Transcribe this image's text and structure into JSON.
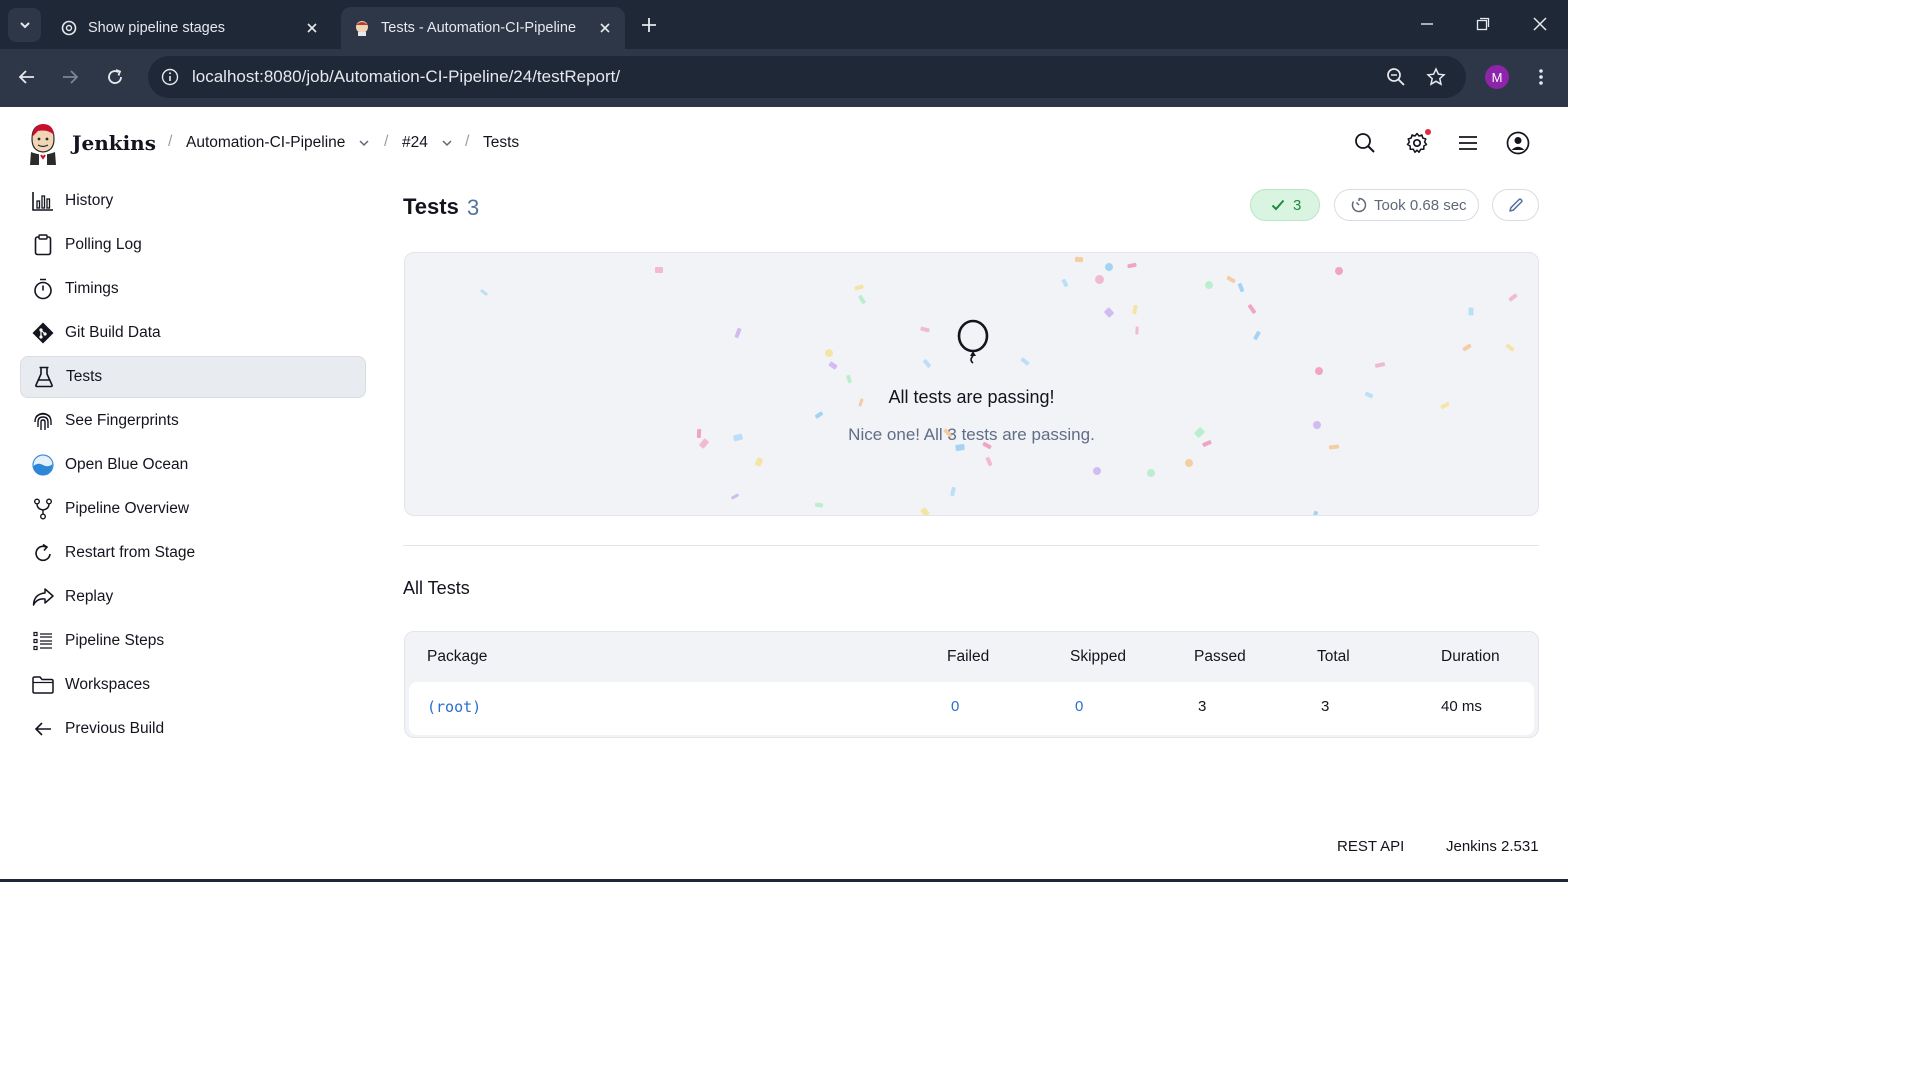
{
  "browser": {
    "tabs": [
      {
        "title": "Show pipeline stages",
        "active": false
      },
      {
        "title": "Tests - Automation-CI-Pipeline",
        "active": true
      }
    ],
    "url": "localhost:8080/job/Automation-CI-Pipeline/24/testReport/",
    "profile_initial": "M"
  },
  "header": {
    "brand": "Jenkins",
    "breadcrumbs": [
      {
        "label": "Automation-CI-Pipeline",
        "has_menu": true
      },
      {
        "label": "#24",
        "has_menu": true
      },
      {
        "label": "Tests",
        "has_menu": false
      }
    ],
    "separator": "/"
  },
  "sidebar": {
    "items": [
      {
        "label": "History",
        "icon": "history-chart-icon"
      },
      {
        "label": "Polling Log",
        "icon": "clipboard-icon"
      },
      {
        "label": "Timings",
        "icon": "stopwatch-icon"
      },
      {
        "label": "Git Build Data",
        "icon": "git-icon"
      },
      {
        "label": "Tests",
        "icon": "flask-icon",
        "active": true
      },
      {
        "label": "See Fingerprints",
        "icon": "fingerprint-icon"
      },
      {
        "label": "Open Blue Ocean",
        "icon": "blue-ocean-icon"
      },
      {
        "label": "Pipeline Overview",
        "icon": "branch-icon"
      },
      {
        "label": "Restart from Stage",
        "icon": "restart-icon"
      },
      {
        "label": "Replay",
        "icon": "replay-icon"
      },
      {
        "label": "Pipeline Steps",
        "icon": "list-icon"
      },
      {
        "label": "Workspaces",
        "icon": "folder-icon"
      },
      {
        "label": "Previous Build",
        "icon": "arrow-left-icon"
      }
    ]
  },
  "main": {
    "title": "Tests",
    "count": "3",
    "passed_badge": "3",
    "duration_badge": "Took 0.68 sec",
    "banner": {
      "title": "All tests are passing!",
      "subtitle": "Nice one! All 3 tests are passing."
    },
    "section_title": "All Tests",
    "table": {
      "columns": [
        "Package",
        "Failed",
        "Skipped",
        "Passed",
        "Total",
        "Duration"
      ],
      "rows": [
        {
          "package": "(root)",
          "failed": "0",
          "skipped": "0",
          "passed": "3",
          "total": "3",
          "duration": "40 ms"
        }
      ]
    }
  },
  "footer": {
    "rest_api": "REST API",
    "version": "Jenkins 2.531"
  },
  "colors": {
    "accent": "#2a6fcd",
    "success": "#1f8a3e",
    "chrome_dark": "#1f2836"
  }
}
